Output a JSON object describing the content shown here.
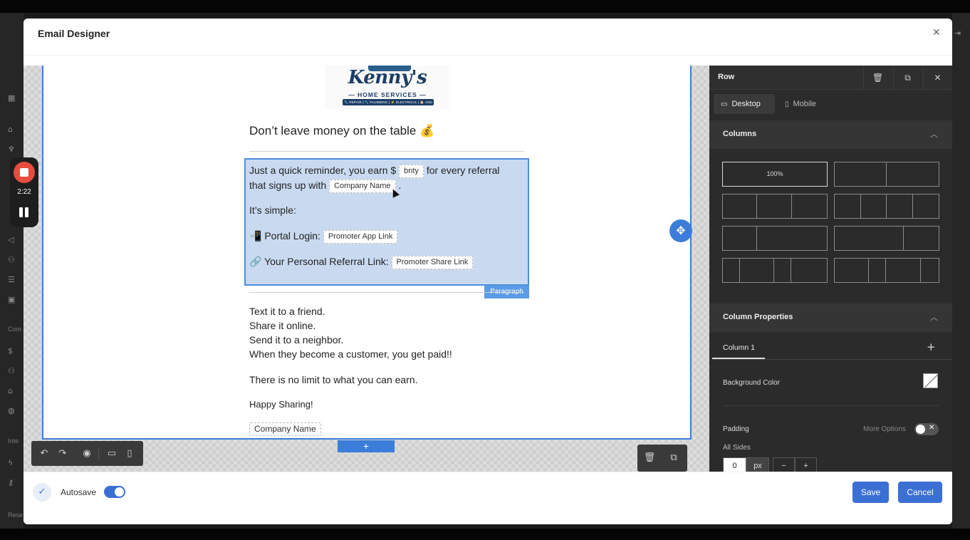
{
  "recorder": {
    "time": "2:22"
  },
  "background": {
    "section_label_1": "Com",
    "section_label_2": "Inte",
    "section_label_3": "Rese"
  },
  "modal": {
    "title": "Email Designer",
    "close_icon": "close-icon"
  },
  "email": {
    "heading": "Don’t leave money on the table 💰",
    "reminder_line1_pre": "Just a quick reminder, you earn $",
    "reminder_tag1": "bnty",
    "reminder_line1_post": "for every referral",
    "reminder_line2_pre": "that signs up with",
    "reminder_tag2": "Company Name",
    "reminder_line2_post": ".",
    "simple": "It’s simple:",
    "portal_label": "📲 Portal Login:",
    "portal_tag": "Promoter App Link",
    "referral_label": "🔗 Your Personal Referral Link:",
    "referral_tag": "Promoter Share Link",
    "paragraph_tag": "Paragraph",
    "lines": [
      "Text it to a friend.",
      "Share it online.",
      "Send it to a neighbor.",
      "When they become a customer, you get paid!!"
    ],
    "no_limit": "There is no limit to what you can earn.",
    "happy": "Happy Sharing!",
    "company_tag": "Company Name",
    "add_row": "+"
  },
  "logo": {
    "main": "Kenny's",
    "sub": "— HOME SERVICES —",
    "services": "🔧 REPAIR | 🔧 PLUMBING | ⚡ ELECTRICAL | 🏠 AND MORE!"
  },
  "panel": {
    "title": "Row",
    "tabs": {
      "desktop": "Desktop",
      "mobile": "Mobile"
    },
    "columns_title": "Columns",
    "layout_selected_label": "100%",
    "column_properties_title": "Column Properties",
    "column_tab": "Column 1",
    "column_add": "+",
    "background_color_label": "Background Color",
    "padding_label": "Padding",
    "more_options_label": "More Options",
    "all_sides_label": "All Sides",
    "padding_value": "0",
    "padding_unit": "px",
    "minus": "−",
    "plus": "+"
  },
  "footer": {
    "autosave_label": "Autosave",
    "autosave_on": true,
    "save_label": "Save",
    "cancel_label": "Cancel"
  },
  "colors": {
    "accent": "#3b6fd4",
    "selection": "#4b8fdc",
    "panel_bg": "#2b2b2b"
  }
}
